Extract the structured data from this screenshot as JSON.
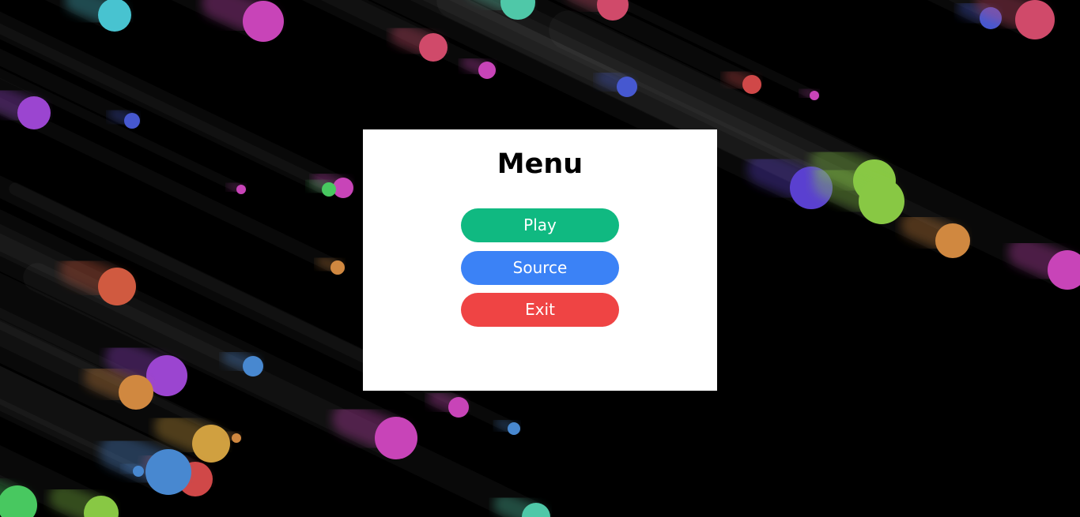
{
  "menu": {
    "title": "Menu",
    "buttons": [
      {
        "id": "play",
        "label": "Play",
        "color": "#10b981"
      },
      {
        "id": "source",
        "label": "Source",
        "color": "#3b82f6"
      },
      {
        "id": "exit",
        "label": "Exit",
        "color": "#ef4444"
      }
    ]
  },
  "background": {
    "color": "#000000",
    "particle_palette": [
      "#48c3d0",
      "#c844b8",
      "#d04a6a",
      "#4fc8a8",
      "#9b45d0",
      "#4658d0",
      "#d04848",
      "#5a40d0",
      "#88c844",
      "#d08840",
      "#d05a40",
      "#4888d0",
      "#d0a040",
      "#48c860"
    ]
  }
}
